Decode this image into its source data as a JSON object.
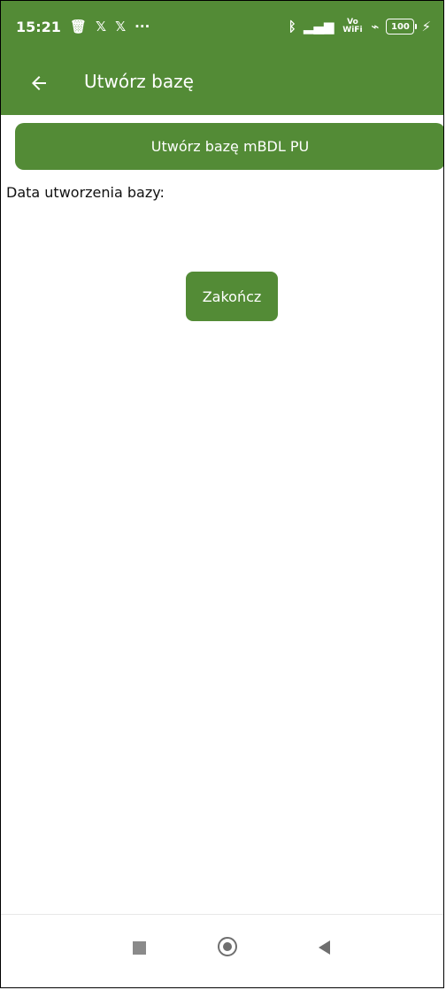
{
  "status_bar": {
    "time": "15:21",
    "icons_left": [
      "trash-icon",
      "x-icon",
      "x-icon",
      "more-icon"
    ],
    "icons_right": [
      "bluetooth-icon",
      "signal-icon",
      "vowifi-icon",
      "wifi-icon",
      "battery-icon",
      "charging-icon"
    ],
    "vowifi_label": "Vo WiFi",
    "battery_level": "100"
  },
  "toolbar": {
    "title": "Utwórz bazę"
  },
  "main": {
    "create_button_label": "Utwórz bazę mBDL PU",
    "date_label": "Data utworzenia bazy:",
    "finish_button_label": "Zakończ"
  },
  "colors": {
    "primary": "#538b36",
    "nav_icon": "#6f6f6f"
  },
  "navigation_bar": {
    "icons": [
      "recent-apps-icon",
      "home-icon",
      "back-icon"
    ]
  }
}
